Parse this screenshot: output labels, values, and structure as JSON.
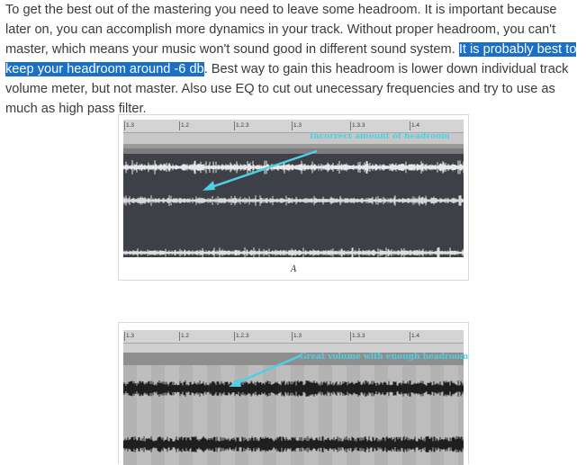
{
  "paragraph": {
    "before": "To get the best out of the mastering you need to leave some headroom. It is important because later on, you can accomplish more dynamics in your track. Without proper headroom, you can't master, which means your music won't sound good in different sound system. ",
    "highlight": "It is probably best to keep your headroom around -6 db",
    "after": ". Best way to gain this headroom is lower down individual track volume meter, but not master. Also use EQ to cut out unecessary frequencies and try to use as much as high pass filter."
  },
  "figure_a": {
    "ruler_ticks": [
      "1.3",
      "1.2",
      "1.2.3",
      "1.3",
      "1.3.3",
      "1.4"
    ],
    "annotation": "Incorrect amount of headroom",
    "caption": "A",
    "arrow_color": "#4dd0e6"
  },
  "figure_b": {
    "ruler_ticks": [
      "1.3",
      "1.2",
      "1.2.3",
      "1.3",
      "1.3.3",
      "1.4"
    ],
    "annotation": "Great volume with enough headroom",
    "arrow_color": "#4dd0e6"
  }
}
